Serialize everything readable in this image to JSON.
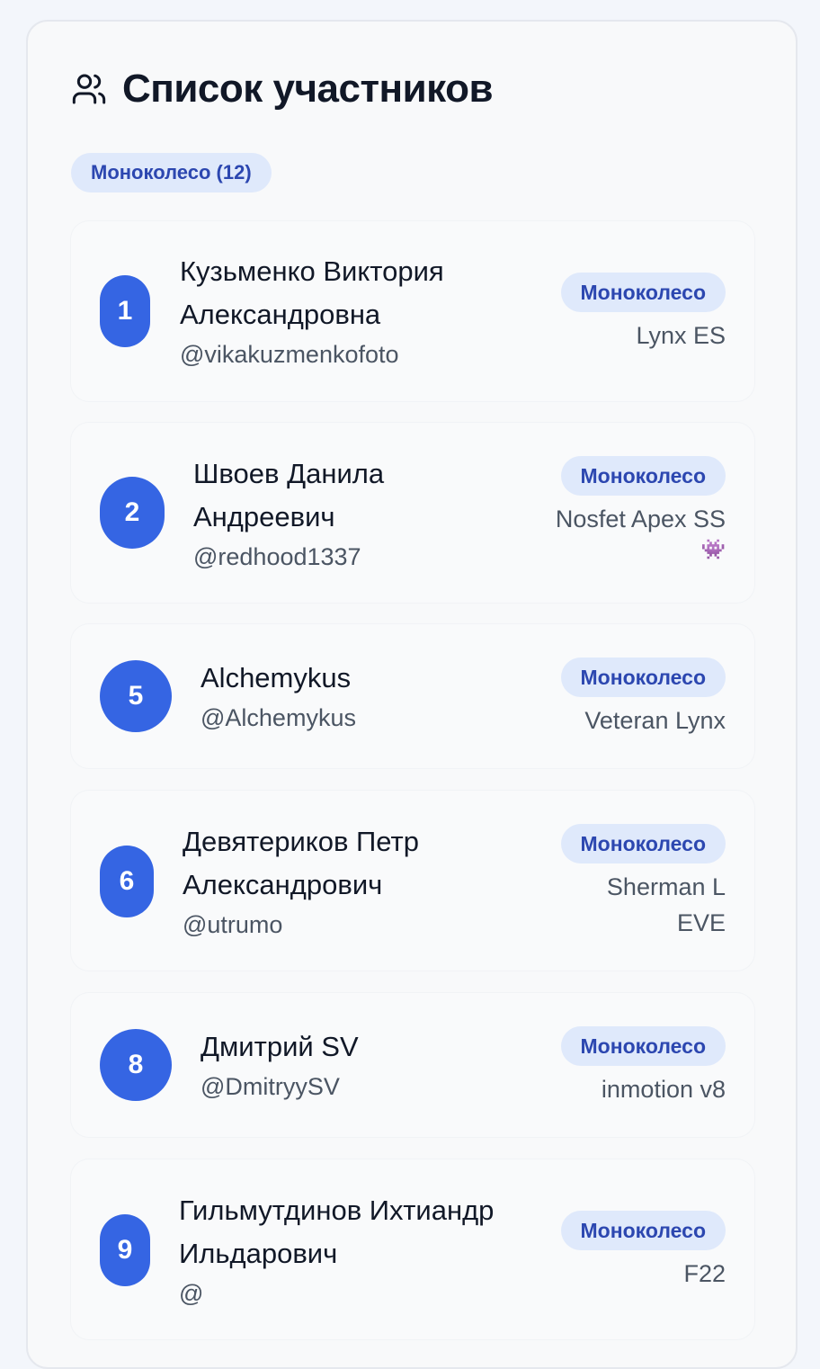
{
  "header": {
    "title": "Список участников",
    "icon": "users-icon"
  },
  "filter": {
    "label": "Моноколесо (12)"
  },
  "participants": [
    {
      "number": "1",
      "name": "Кузьменко Виктория Александровна",
      "handle": "@vikakuzmenkofoto",
      "category": "Моноколесо",
      "model": "Lynx ES"
    },
    {
      "number": "2",
      "name": "Швоев Данила Андреевич",
      "handle": "@redhood1337",
      "category": "Моноколесо",
      "model": "Nosfet Apex SS",
      "emoji": "👾"
    },
    {
      "number": "5",
      "name": "Alchemykus",
      "handle": "@Alchemykus",
      "category": "Моноколесо",
      "model": "Veteran Lynx"
    },
    {
      "number": "6",
      "name": "Девятериков Петр Александрович",
      "handle": "@utrumo",
      "category": "Моноколесо",
      "model": "Sherman L EVE"
    },
    {
      "number": "8",
      "name": "Дмитрий SV",
      "handle": "@DmitryySV",
      "category": "Моноколесо",
      "model": "inmotion v8"
    },
    {
      "number": "9",
      "name": "Гильмутдинов Ихтиандр Ильдарович",
      "handle": "@",
      "category": "Моноколесо",
      "model": "F22"
    }
  ]
}
